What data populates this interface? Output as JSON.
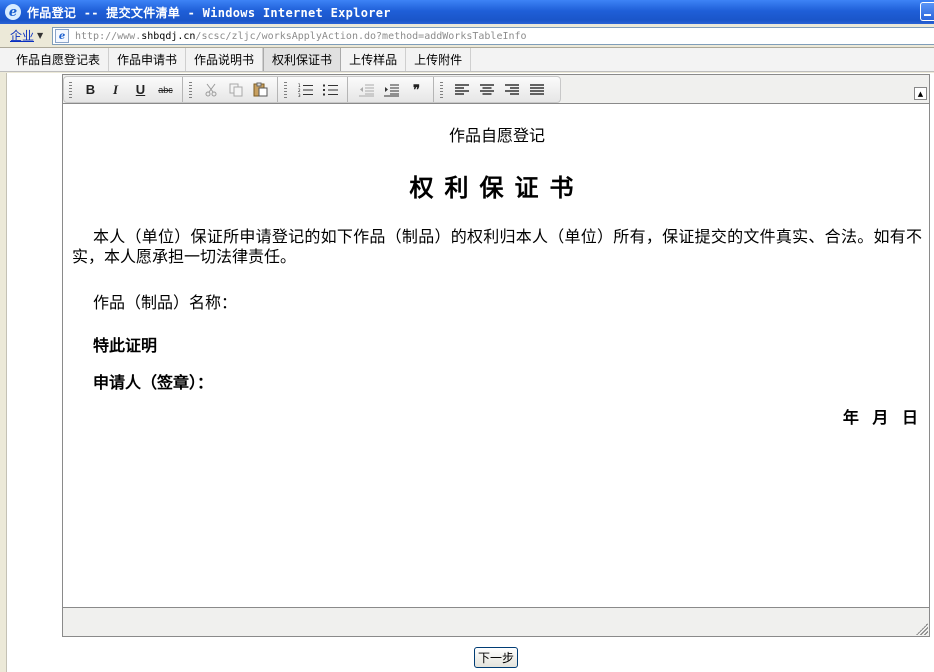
{
  "window": {
    "title": "作品登记 -- 提交文件清单 - Windows Internet Explorer"
  },
  "address": {
    "zone": "企业",
    "url_prefix": "http://www.",
    "url_domain": "shbqdj.cn",
    "url_path": "/scsc/zljc/worksApplyAction.do?method=addWorksTableInfo"
  },
  "tabs": [
    {
      "label": "作品自愿登记表",
      "active": false
    },
    {
      "label": "作品申请书",
      "active": false
    },
    {
      "label": "作品说明书",
      "active": false
    },
    {
      "label": "权利保证书",
      "active": true
    },
    {
      "label": "上传样品",
      "active": false
    },
    {
      "label": "上传附件",
      "active": false
    }
  ],
  "toolbar": {
    "bold": "B",
    "italic": "I",
    "underline": "U",
    "strike": "abc",
    "quote": "❞",
    "icons": [
      "bold-icon",
      "italic-icon",
      "underline-icon",
      "strikethrough-icon",
      "cut-icon",
      "copy-icon",
      "paste-icon",
      "ordered-list-icon",
      "unordered-list-icon",
      "outdent-icon",
      "indent-icon",
      "blockquote-icon",
      "align-left-icon",
      "align-center-icon",
      "align-right-icon",
      "align-justify-icon"
    ]
  },
  "document": {
    "header": "作品自愿登记",
    "title": "权利保证书",
    "body": "本人（单位）保证所申请登记的如下作品（制品）的权利归本人（单位）所有，保证提交的文件真实、合法。如有不实，本人愿承担一切法律责任。",
    "work_name_label": "作品（制品）名称：",
    "certify": "特此证明",
    "applicant": "申请人（签章）：",
    "date": "年  月  日"
  },
  "actions": {
    "next": "下一步"
  }
}
